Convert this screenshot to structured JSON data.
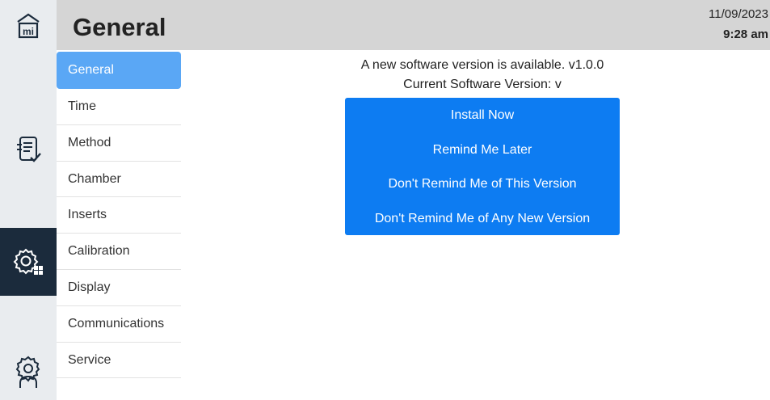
{
  "header": {
    "title": "General",
    "date": "11/09/2023",
    "time": "9:28 am"
  },
  "rail": {
    "icons": [
      "home-icon",
      "method-checklist-icon",
      "settings-gear-grid-icon",
      "service-user-gear-icon"
    ],
    "active_color": "#1b2b3c"
  },
  "submenu": {
    "items": [
      {
        "label": "General",
        "active": true
      },
      {
        "label": "Time"
      },
      {
        "label": "Method"
      },
      {
        "label": "Chamber"
      },
      {
        "label": "Inserts"
      },
      {
        "label": "Calibration"
      },
      {
        "label": "Display"
      },
      {
        "label": "Communications"
      },
      {
        "label": "Service"
      }
    ],
    "active_color": "#5aa7f5"
  },
  "main": {
    "message": "A new software version is available. v1.0.0",
    "current_version": "Current Software Version: v",
    "buttons": {
      "install": "Install Now",
      "remind_later": "Remind Me Later",
      "dont_remind_version": "Don't Remind Me of This Version",
      "dont_remind_any": "Don't Remind Me of Any New Version"
    },
    "button_color": "#0d7cf2"
  }
}
